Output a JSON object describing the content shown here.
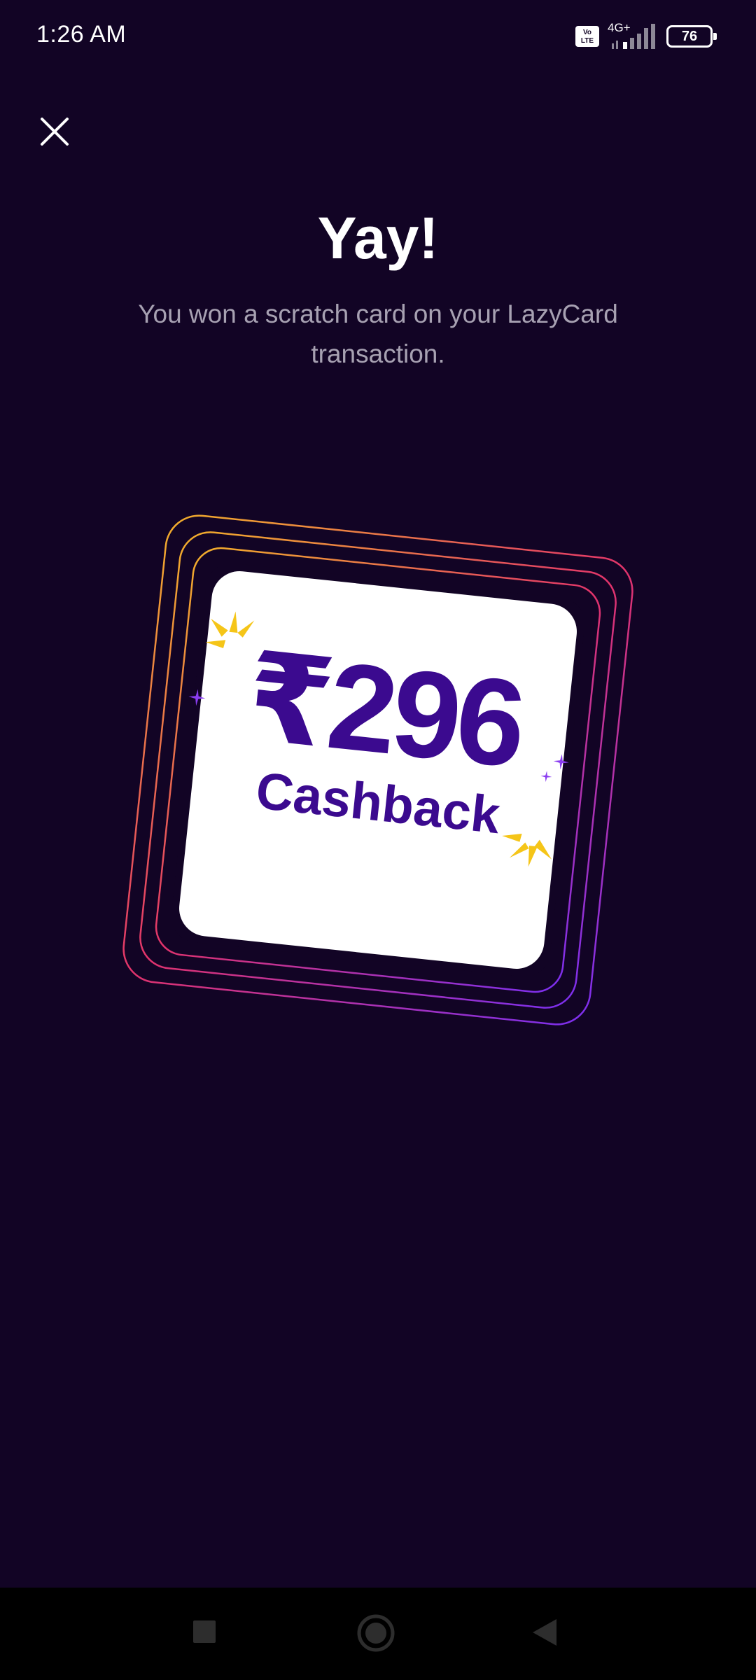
{
  "status_bar": {
    "time": "1:26 AM",
    "volte_label": "Vo\nLTE",
    "network_label": "4G+",
    "battery_level": "76"
  },
  "header": {
    "close_icon": "close-icon"
  },
  "main": {
    "title": "Yay!",
    "subtitle": "You won a scratch card on your LazyCard transaction."
  },
  "scratch_card": {
    "amount": "₹296",
    "label": "Cashback",
    "colors": {
      "text": "#3b0a8f",
      "sparkle": "#f5c518",
      "ring_start": "#f2b02a",
      "ring_mid": "#e2336b",
      "ring_end": "#7b2ff2"
    }
  },
  "nav_bar": {
    "recents_icon": "square-icon",
    "home_icon": "circle-icon",
    "back_icon": "triangle-back-icon"
  }
}
